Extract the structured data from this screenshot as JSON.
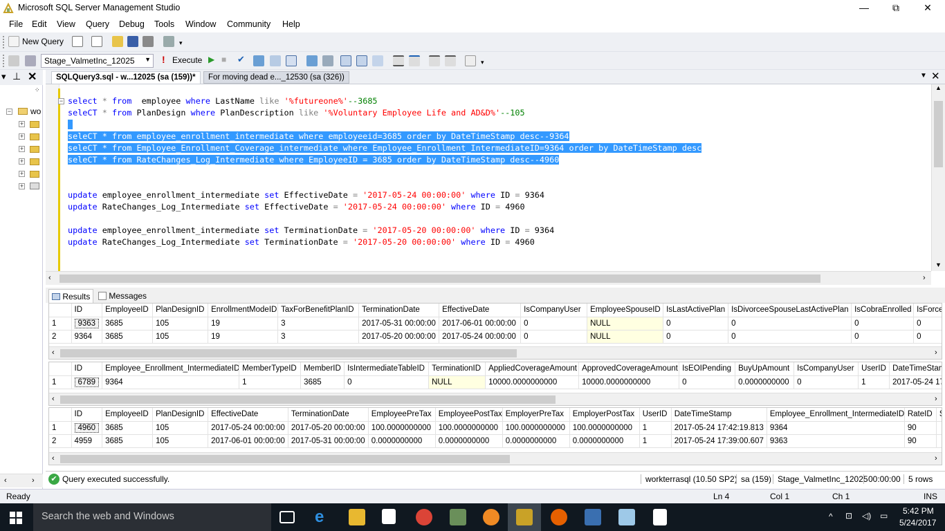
{
  "window": {
    "title": "Microsoft SQL Server Management Studio",
    "minimize": "—",
    "restore": "⧉",
    "close": "✕"
  },
  "menu": [
    "File",
    "Edit",
    "View",
    "Query",
    "Debug",
    "Tools",
    "Window",
    "Community",
    "Help"
  ],
  "toolbar": {
    "new_query": "New Query",
    "database": "Stage_ValmetInc_12025",
    "execute": "Execute"
  },
  "tabs": [
    {
      "label": "SQLQuery3.sql - w...12025 (sa (159))*",
      "active": true
    },
    {
      "label": "For moving dead e..._12530 (sa (326))",
      "active": false
    }
  ],
  "object_explorer": {
    "root": "wo"
  },
  "editor": {
    "lines": [
      [
        [
          "kw",
          "select"
        ],
        [
          "gr",
          " * "
        ],
        [
          "kw",
          "from"
        ],
        [
          "",
          "  employee "
        ],
        [
          "kw",
          "where"
        ],
        [
          "",
          " LastName "
        ],
        [
          "gr",
          "like"
        ],
        [
          "",
          ""
        ],
        [
          "st",
          " '%futureone%'"
        ],
        [
          "cm",
          "--3685"
        ]
      ],
      [
        [
          "kw",
          "seleCT"
        ],
        [
          "gr",
          " * "
        ],
        [
          "kw",
          "from"
        ],
        [
          "",
          " PlanDesign "
        ],
        [
          "kw",
          "where"
        ],
        [
          "",
          " PlanDescription "
        ],
        [
          "gr",
          "like"
        ],
        [
          "st",
          " '%Voluntary Employee Life and AD&D%'"
        ],
        [
          "cm",
          "--105"
        ]
      ],
      [],
      [
        [
          "kw",
          "seleCT"
        ],
        [
          "gr",
          " * "
        ],
        [
          "kw",
          "from"
        ],
        [
          "",
          " employee_enrollment_intermediate "
        ],
        [
          "kw",
          "where"
        ],
        [
          "",
          " employeeid"
        ],
        [
          "gr",
          "="
        ],
        [
          "",
          "3685 "
        ],
        [
          "kw",
          "order by"
        ],
        [
          "",
          " DateTimeStamp "
        ],
        [
          "kw",
          "desc"
        ],
        [
          "cm",
          "--9364"
        ]
      ],
      [
        [
          "kw",
          "seleCT"
        ],
        [
          "gr",
          " * "
        ],
        [
          "kw",
          "from"
        ],
        [
          "",
          " Employee_Enrollment_Coverage_intermediate "
        ],
        [
          "kw",
          "where"
        ],
        [
          "",
          " Employee_Enrollment_IntermediateID"
        ],
        [
          "gr",
          "="
        ],
        [
          "",
          "9364 "
        ],
        [
          "kw",
          "order by"
        ],
        [
          "",
          " DateTimeStamp "
        ],
        [
          "kw",
          "desc"
        ]
      ],
      [
        [
          "kw",
          "seleCT"
        ],
        [
          "gr",
          " * "
        ],
        [
          "kw",
          "from"
        ],
        [
          "",
          " RateChanges_Log_Intermediate "
        ],
        [
          "kw",
          "where"
        ],
        [
          "",
          " EmployeeID "
        ],
        [
          "gr",
          "="
        ],
        [
          "",
          " 3685 "
        ],
        [
          "kw",
          "order by"
        ],
        [
          "",
          " DateTimeStamp "
        ],
        [
          "kw",
          "desc"
        ],
        [
          "cm",
          "--4960"
        ]
      ],
      [],
      [],
      [
        [
          "kw",
          "update"
        ],
        [
          "",
          " employee_enrollment_intermediate "
        ],
        [
          "kw",
          "set"
        ],
        [
          "",
          " EffectiveDate "
        ],
        [
          "gr",
          "="
        ],
        [
          "st",
          " '2017-05-24 00:00:00'"
        ],
        [
          "kw",
          " where"
        ],
        [
          "",
          " ID "
        ],
        [
          "gr",
          "="
        ],
        [
          "",
          " 9364"
        ]
      ],
      [
        [
          "kw",
          "update"
        ],
        [
          "",
          " RateChanges_Log_Intermediate "
        ],
        [
          "kw",
          "set"
        ],
        [
          "",
          " EffectiveDate "
        ],
        [
          "gr",
          "="
        ],
        [
          "st",
          " '2017-05-24 00:00:00'"
        ],
        [
          "kw",
          " where"
        ],
        [
          "",
          " ID "
        ],
        [
          "gr",
          "="
        ],
        [
          "",
          " 4960"
        ]
      ],
      [],
      [
        [
          "kw",
          "update"
        ],
        [
          "",
          " employee_enrollment_intermediate "
        ],
        [
          "kw",
          "set"
        ],
        [
          "",
          " TerminationDate "
        ],
        [
          "gr",
          "="
        ],
        [
          "st",
          " '2017-05-20 00:00:00'"
        ],
        [
          "kw",
          " where"
        ],
        [
          "",
          " ID "
        ],
        [
          "gr",
          "="
        ],
        [
          "",
          " 9364"
        ]
      ],
      [
        [
          "kw",
          "update"
        ],
        [
          "",
          " RateChanges_Log_Intermediate "
        ],
        [
          "kw",
          "set"
        ],
        [
          "",
          " TerminationDate "
        ],
        [
          "gr",
          "="
        ],
        [
          "st",
          " '2017-05-20 00:00:00'"
        ],
        [
          "kw",
          " where"
        ],
        [
          "",
          " ID "
        ],
        [
          "gr",
          "="
        ],
        [
          "",
          " 4960"
        ]
      ]
    ]
  },
  "result_tabs": {
    "results": "Results",
    "messages": "Messages"
  },
  "grids": [
    {
      "columns": [
        "ID",
        "EmployeeID",
        "PlanDesignID",
        "EnrollmentModeID",
        "TaxForBenefitPlanID",
        "TerminationDate",
        "EffectiveDate",
        "IsCompanyUser",
        "EmployeeSpouseID",
        "IsLastActivePlan",
        "IsDivorceeSpouseLastActivePlan",
        "IsCobraEnrolled",
        "IsForcedPl"
      ],
      "rows": [
        [
          "1",
          "9363",
          "3685",
          "105",
          "19",
          "3",
          "2017-05-31 00:00:00",
          "2017-06-01 00:00:00",
          "0",
          "NULL",
          "0",
          "0",
          "0",
          "0"
        ],
        [
          "2",
          "9364",
          "3685",
          "105",
          "19",
          "3",
          "2017-05-20 00:00:00",
          "2017-05-24 00:00:00",
          "0",
          "NULL",
          "0",
          "0",
          "0",
          "0"
        ]
      ]
    },
    {
      "columns": [
        "ID",
        "Employee_Enrollment_IntermediateID",
        "MemberTypeID",
        "MemberID",
        "IsIntermediateTableID",
        "TerminationID",
        "AppliedCoverageAmount",
        "ApprovedCoverageAmount",
        "IsEOIPending",
        "BuyUpAmount",
        "IsCompanyUser",
        "UserID",
        "DateTimeStam"
      ],
      "rows": [
        [
          "1",
          "6789",
          "9364",
          "1",
          "3685",
          "0",
          "NULL",
          "10000.0000000000",
          "10000.0000000000",
          "0",
          "0.0000000000",
          "0",
          "1",
          "2017-05-24 17"
        ]
      ]
    },
    {
      "columns": [
        "ID",
        "EmployeeID",
        "PlanDesignID",
        "EffectiveDate",
        "TerminationDate",
        "EmployeePreTax",
        "EmployeePostTax",
        "EmployerPreTax",
        "EmployerPostTax",
        "UserID",
        "DateTimeStamp",
        "Employee_Enrollment_IntermediateID",
        "RateID",
        "S"
      ],
      "rows": [
        [
          "1",
          "4960",
          "3685",
          "105",
          "2017-05-24 00:00:00",
          "2017-05-20 00:00:00",
          "100.0000000000",
          "100.0000000000",
          "100.0000000000",
          "100.0000000000",
          "1",
          "2017-05-24 17:42:19.813",
          "9364",
          "90",
          ""
        ],
        [
          "2",
          "4959",
          "3685",
          "105",
          "2017-06-01 00:00:00",
          "2017-05-31 00:00:00",
          "0.0000000000",
          "0.0000000000",
          "0.0000000000",
          "0.0000000000",
          "1",
          "2017-05-24 17:39:00.607",
          "9363",
          "90",
          ""
        ]
      ]
    }
  ],
  "query_status": {
    "message": "Query executed successfully.",
    "server": "workterrasql (10.50 SP2)",
    "user": "sa (159)",
    "database": "Stage_ValmetInc_12025",
    "time": "00:00:00",
    "rows": "5 rows"
  },
  "app_status": {
    "ready": "Ready",
    "ln": "Ln 4",
    "col": "Col 1",
    "ch": "Ch 1",
    "ins": "INS"
  },
  "taskbar": {
    "search": "Search the web and Windows",
    "time": "5:42 PM",
    "date": "5/24/2017"
  }
}
